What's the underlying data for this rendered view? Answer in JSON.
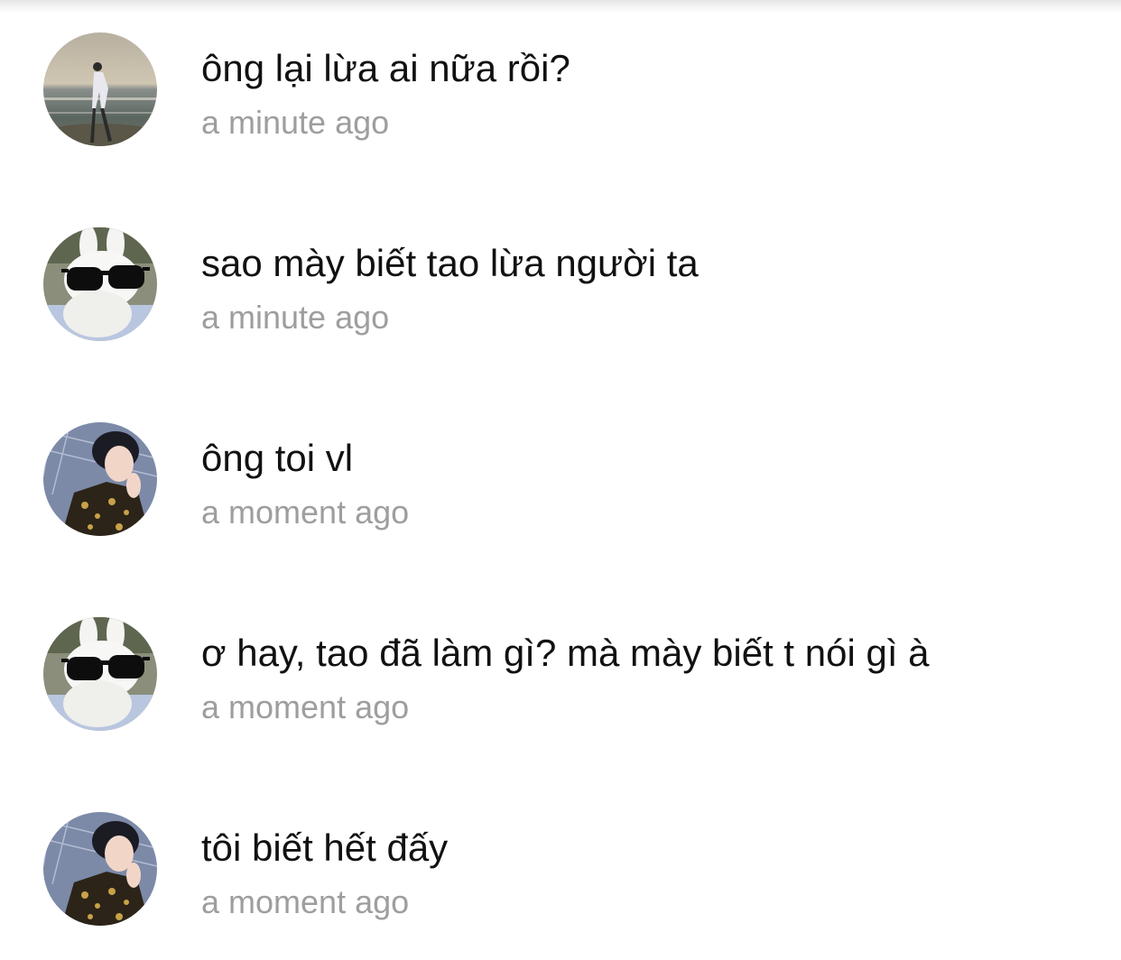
{
  "comments": [
    {
      "avatar": "beach-man-avatar",
      "text": "ông lại lừa ai nữa rồi?",
      "time": "a minute ago"
    },
    {
      "avatar": "rabbit-sunglasses-avatar",
      "text": "sao mày biết tao lừa người ta",
      "time": "a minute ago"
    },
    {
      "avatar": "idol-portrait-avatar",
      "text": "ông toi vl",
      "time": "a moment ago"
    },
    {
      "avatar": "rabbit-sunglasses-avatar",
      "text": "ơ hay, tao đã làm gì? mà mày biết t nói gì à",
      "time": "a moment ago"
    },
    {
      "avatar": "idol-portrait-avatar",
      "text": "tôi biết hết đấy",
      "time": "a moment ago"
    }
  ]
}
